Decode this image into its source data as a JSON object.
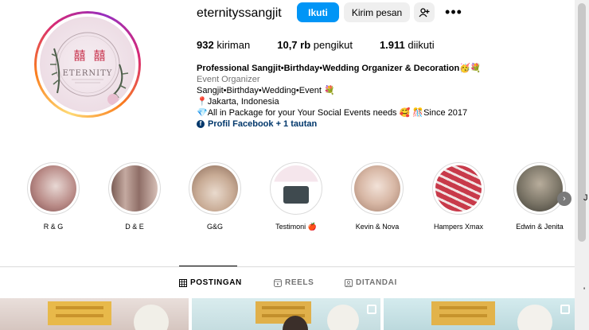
{
  "profile": {
    "username": "eternityssangjit",
    "follow_label": "Ikuti",
    "message_label": "Kirim pesan",
    "add_user_icon": "person-plus-icon",
    "more_icon": "ellipsis-icon",
    "more_label": "•••",
    "avatar_text": "ETERNITY"
  },
  "stats": [
    {
      "count": "932",
      "label": "kiriman"
    },
    {
      "count": "10,7 rb",
      "label": "pengikut"
    },
    {
      "count": "1.911",
      "label": "diikuti"
    }
  ],
  "bio": {
    "name": "Professional Sangjit•Birthday•Wedding Organizer & Decoration🥳💐",
    "category": "Event Organizer",
    "line1": "Sangjit•Birthday•Wedding•Event 💐",
    "line2": "📍Jakarta, Indonesia",
    "line3": "💎All in Package for your Your Social Events needs 🥰 🎊Since 2017",
    "link_text": "Profil Facebook + 1 tautan",
    "link_icon": "facebook-icon"
  },
  "highlights": [
    {
      "label": "R & G",
      "color": "#c9a0a0"
    },
    {
      "label": "D & E",
      "color": "#b58a8a"
    },
    {
      "label": "G&G",
      "color": "#d9b9a6"
    },
    {
      "label": "Testimoni 🍎",
      "color": "#f3dde6"
    },
    {
      "label": "Kevin & Nova",
      "color": "#e6cfc6"
    },
    {
      "label": "Hampers Xmax",
      "color": "#c83a4a"
    },
    {
      "label": "Edwin & Jenita",
      "color": "#7a7466"
    }
  ],
  "highlights_next_icon": "chevron-right-icon",
  "tabs": [
    {
      "label": "POSTINGAN",
      "icon": "grid-icon",
      "active": true
    },
    {
      "label": "REELS",
      "icon": "reels-icon",
      "active": false
    },
    {
      "label": "DITANDAI",
      "icon": "tagged-icon",
      "active": false
    }
  ],
  "colors": {
    "accent": "#0095f6",
    "link": "#00376b",
    "muted": "#737373",
    "border": "#dbdbdb"
  },
  "edge_glyph": "J",
  "edge_glyph2": "'"
}
